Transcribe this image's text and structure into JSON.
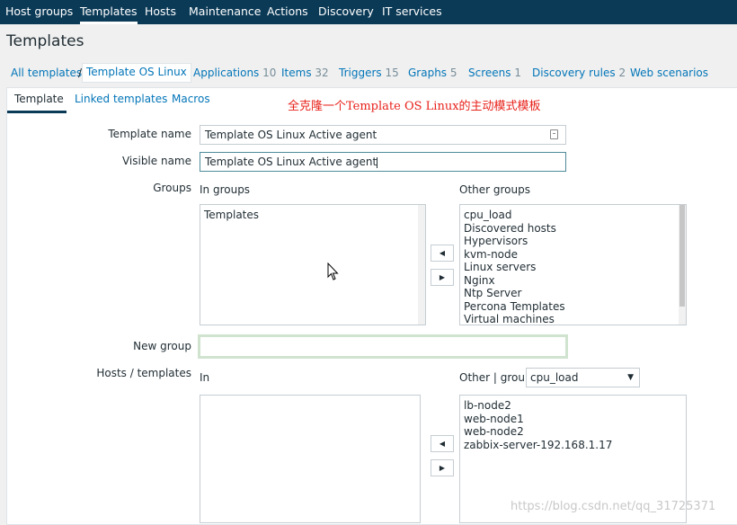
{
  "topnav": {
    "items": [
      "Host groups",
      "Templates",
      "Hosts",
      "Maintenance",
      "Actions",
      "Discovery",
      "IT services"
    ],
    "active": "Templates"
  },
  "page_title": "Templates",
  "breadcrumbs": {
    "all": "All templates",
    "separator": "/",
    "current": "Template OS Linux",
    "links": [
      {
        "label": "Applications",
        "count": "10"
      },
      {
        "label": "Items",
        "count": "32"
      },
      {
        "label": "Triggers",
        "count": "15"
      },
      {
        "label": "Graphs",
        "count": "5"
      },
      {
        "label": "Screens",
        "count": "1"
      },
      {
        "label": "Discovery rules",
        "count": "2"
      },
      {
        "label": "Web scenarios",
        "count": ""
      }
    ]
  },
  "tabs": [
    "Template",
    "Linked templates",
    "Macros"
  ],
  "annotation": "全克隆一个Template OS Linux的主动模式模板",
  "form": {
    "template_name_label": "Template name",
    "template_name_value": "Template OS Linux Active agent",
    "visible_name_label": "Visible name",
    "visible_name_value": "Template OS Linux Active agent",
    "groups_label": "Groups",
    "in_groups_label": "In groups",
    "in_groups": [
      "Templates"
    ],
    "other_groups_label": "Other groups",
    "other_groups": [
      "cpu_load",
      "Discovered hosts",
      "Hypervisors",
      "kvm-node",
      "Linux servers",
      "Nginx",
      "Ntp Server",
      "Percona Templates",
      "Virtual machines"
    ],
    "new_group_label": "New group",
    "new_group_value": "",
    "hosts_templates_label": "Hosts / templates",
    "in_label": "In",
    "other_group_label": "Other | group",
    "group_select_value": "cpu_load",
    "other_hosts": [
      "lb-node2",
      "web-node1",
      "web-node2",
      "zabbix-server-192.168.1.17"
    ]
  },
  "icons": {
    "left_arrow": "◀",
    "right_arrow": "▶",
    "dropdown": "▼"
  },
  "watermark": "https://blog.csdn.net/qq_31725371"
}
